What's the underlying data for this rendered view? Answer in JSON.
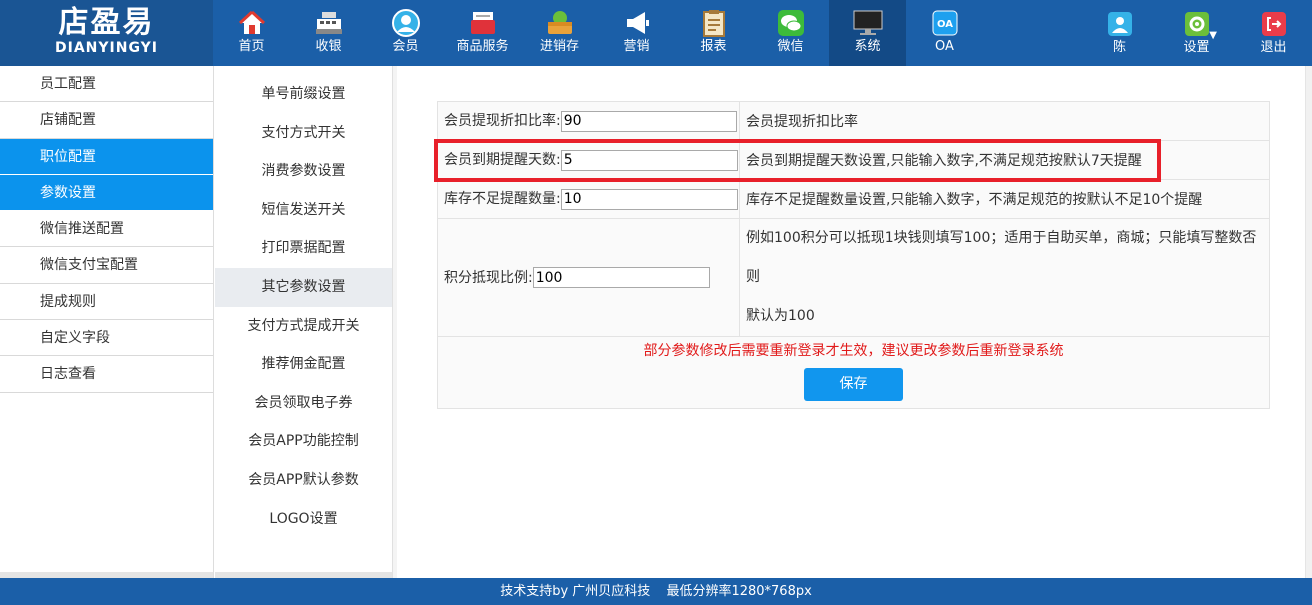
{
  "logo": {
    "cn": "店盈易",
    "en": "DIANYINGYI"
  },
  "nav": [
    {
      "label": "首页",
      "icon": "home-icon"
    },
    {
      "label": "收银",
      "icon": "cash-register-icon"
    },
    {
      "label": "会员",
      "icon": "member-icon"
    },
    {
      "label": "商品服务",
      "icon": "product-icon"
    },
    {
      "label": "进销存",
      "icon": "inventory-icon"
    },
    {
      "label": "营销",
      "icon": "megaphone-icon"
    },
    {
      "label": "报表",
      "icon": "report-icon"
    },
    {
      "label": "微信",
      "icon": "wechat-icon"
    },
    {
      "label": "系统",
      "icon": "monitor-icon",
      "active": true
    },
    {
      "label": "OA",
      "icon": "oa-icon"
    }
  ],
  "right_nav": {
    "user": "陈",
    "settings": "设置",
    "logout": "退出"
  },
  "sidebar": [
    {
      "label": "员工配置"
    },
    {
      "label": "店铺配置"
    },
    {
      "label": "职位配置",
      "active": true
    },
    {
      "label": "参数设置",
      "active": true
    },
    {
      "label": "微信推送配置"
    },
    {
      "label": "微信支付宝配置"
    },
    {
      "label": "提成规则"
    },
    {
      "label": "自定义字段"
    },
    {
      "label": "日志查看"
    }
  ],
  "submenu": [
    {
      "label": "单号前缀设置"
    },
    {
      "label": "支付方式开关"
    },
    {
      "label": "消费参数设置"
    },
    {
      "label": "短信发送开关"
    },
    {
      "label": "打印票据配置"
    },
    {
      "label": "其它参数设置",
      "active": true
    },
    {
      "label": "支付方式提成开关"
    },
    {
      "label": "推荐佣金配置"
    },
    {
      "label": "会员领取电子券"
    },
    {
      "label": "会员APP功能控制"
    },
    {
      "label": "会员APP默认参数"
    },
    {
      "label": "LOGO设置"
    }
  ],
  "params": [
    {
      "label": "会员提现折扣比率:",
      "value": "90",
      "desc": "会员提现折扣比率"
    },
    {
      "label": "会员到期提醒天数:",
      "value": "5",
      "desc": "会员到期提醒天数设置,只能输入数字,不满足规范按默认7天提醒"
    },
    {
      "label": "库存不足提醒数量:",
      "value": "10",
      "desc": "库存不足提醒数量设置,只能输入数字，不满足规范的按默认不足10个提醒"
    },
    {
      "label": "积分抵现比例:",
      "value": "100",
      "desc_line1": "例如100积分可以抵现1块钱则填写100；适用于自助买单，商城；只能填写整数否则",
      "desc_line2": "默认为100"
    }
  ],
  "notice": "部分参数修改后需要重新登录才生效，建议更改参数后重新登录系统",
  "save_label": "保存",
  "footer": {
    "support": "技术支持by 广州贝应科技",
    "resolution": "最低分辨率1280*768px"
  },
  "colors": {
    "header": "#1b5fa8",
    "active": "#0b93ed",
    "highlight": "#e8202a",
    "notice": "#e11a1a"
  }
}
